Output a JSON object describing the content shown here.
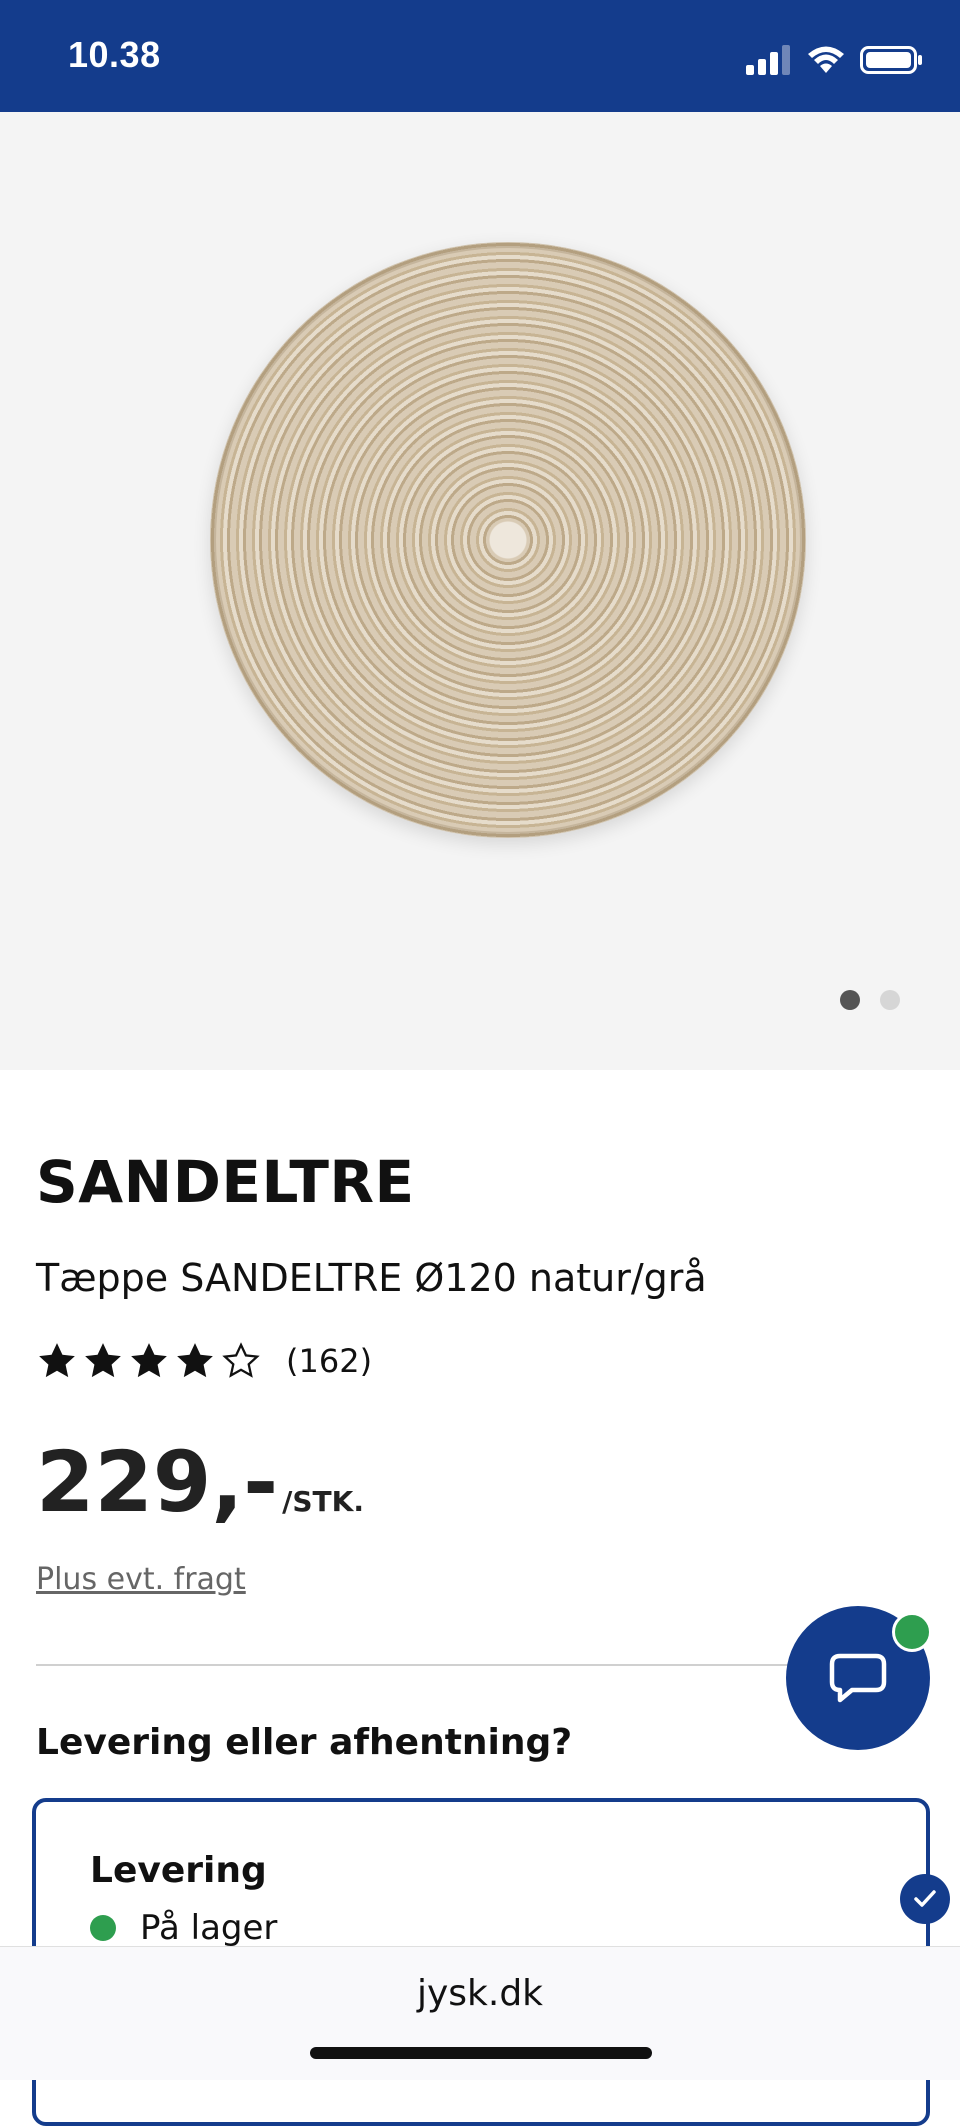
{
  "status_bar": {
    "time": "10.38"
  },
  "gallery": {
    "slide_count": 2,
    "active_slide": 1
  },
  "product": {
    "brand": "SANDELTRE",
    "description": "Tæppe SANDELTRE Ø120 natur/grå",
    "rating": {
      "stars": 4,
      "max_stars": 5,
      "count": "(162)"
    },
    "price": "229,-",
    "unit": "/STK.",
    "freight_link": "Plus evt. fragt"
  },
  "delivery": {
    "heading": "Levering eller afhentning?",
    "option_title": "Levering",
    "stock_status": "På lager",
    "status_color": "#2e9e4f"
  },
  "browser": {
    "url": "jysk.dk"
  },
  "colors": {
    "brand_blue": "#143C8C",
    "online_green": "#2e9e4f"
  }
}
